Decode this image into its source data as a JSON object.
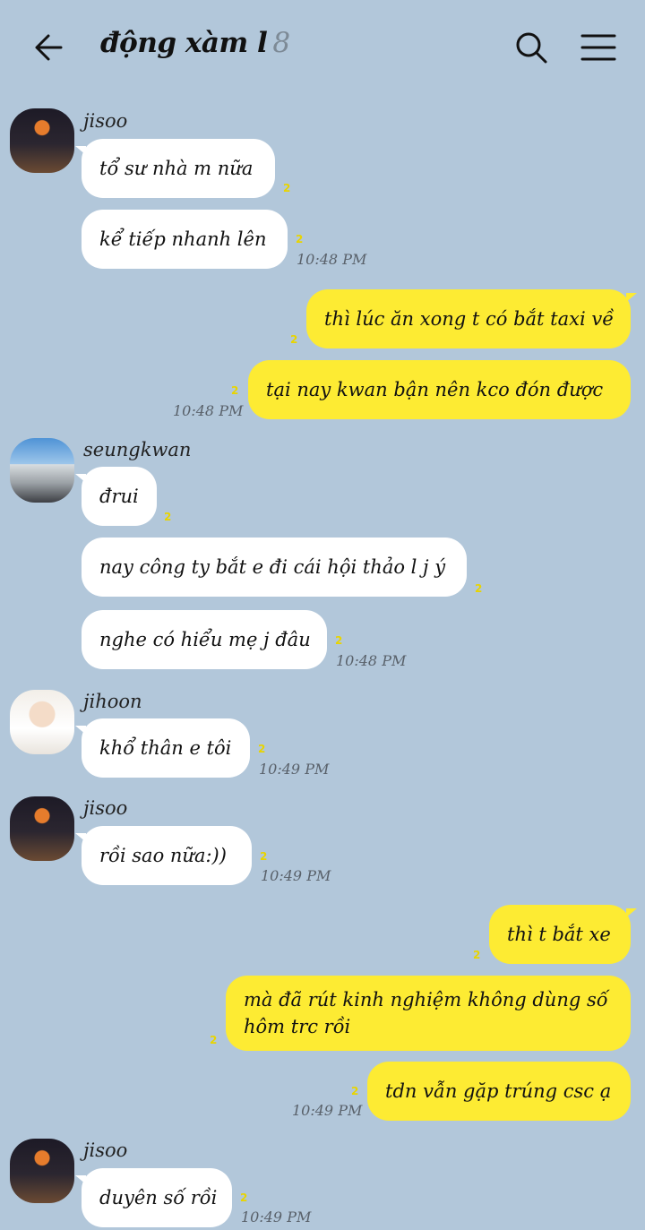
{
  "header": {
    "title": "động xàm l",
    "member_count": "8",
    "back_icon": "arrow-left-icon",
    "search_icon": "search-icon",
    "menu_icon": "hamburger-menu-icon"
  },
  "messages": {
    "g1": {
      "sender": "jisoo",
      "b1": "tổ sư nhà m nữa",
      "b1_unread": "2",
      "b2": "kể tiếp nhanh lên",
      "b2_unread": "2",
      "time": "10:48 PM"
    },
    "g2": {
      "b1": "thì lúc ăn xong t có bắt taxi về",
      "b1_unread": "2",
      "b2": "tại nay kwan bận nên kco đón được",
      "b2_unread": "2",
      "time": "10:48 PM"
    },
    "g3": {
      "sender": "seungkwan",
      "b1": "đrui",
      "b1_unread": "2",
      "b2": "nay công ty bắt e đi cái hội thảo l j ý",
      "b2_unread": "2",
      "b3": "nghe có hiểu mẹ j đâu",
      "b3_unread": "2",
      "time": "10:48 PM"
    },
    "g4": {
      "sender": "jihoon",
      "b1": "khổ thân e tôi",
      "b1_unread": "2",
      "time": "10:49 PM"
    },
    "g5": {
      "sender": "jisoo",
      "b1": "rồi sao nữa:))",
      "b1_unread": "2",
      "time": "10:49 PM"
    },
    "g6": {
      "b1": "thì t bắt xe",
      "b1_unread": "2",
      "b2": "mà đã rút kinh nghiệm không dùng số hôm trc rồi",
      "b2_unread": "2",
      "b3": "tdn vẫn gặp trúng csc ạ",
      "b3_unread": "2",
      "time": "10:49 PM"
    },
    "g7": {
      "sender": "jisoo",
      "b1": "duyên số rồi",
      "b1_unread": "2",
      "time": "10:49 PM"
    }
  }
}
